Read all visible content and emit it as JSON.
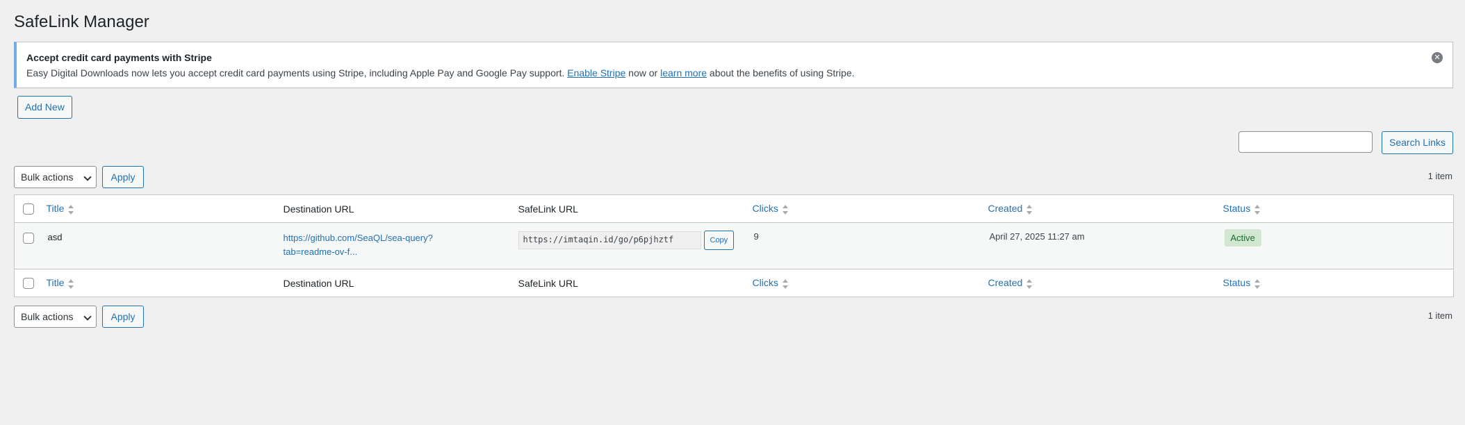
{
  "page": {
    "title": "SafeLink Manager"
  },
  "notice": {
    "title": "Accept credit card payments with Stripe",
    "msg_before": "Easy Digital Downloads now lets you accept credit card payments using Stripe, including Apple Pay and Google Pay support.",
    "enable_link": "Enable Stripe",
    "msg_middle": "now or",
    "learn_link": "learn more",
    "msg_after": "about the benefits of using Stripe.",
    "dismiss_icon": "close-icon"
  },
  "actions": {
    "add_new": "Add New",
    "search_button": "Search Links",
    "search_value": "",
    "bulk_select": "Bulk actions",
    "apply": "Apply",
    "count": "1 item"
  },
  "table": {
    "columns": {
      "title": "Title",
      "destination": "Destination URL",
      "safelink": "SafeLink URL",
      "clicks": "Clicks",
      "created": "Created",
      "status": "Status"
    },
    "rows": [
      {
        "title": "asd",
        "destination": "https://github.com/SeaQL/sea-query?tab=readme-ov-f...",
        "safelink": "https://imtaqin.id/go/p6pjhztf",
        "copy": "Copy",
        "clicks": "9",
        "created": "April 27, 2025 11:27 am",
        "status": "Active"
      }
    ]
  },
  "colors": {
    "accent": "#2271b1",
    "background": "#f0f0f1",
    "notice_border": "#72aee6",
    "status_active_bg": "#d1e7d1",
    "status_active_text": "#1e6b29"
  }
}
